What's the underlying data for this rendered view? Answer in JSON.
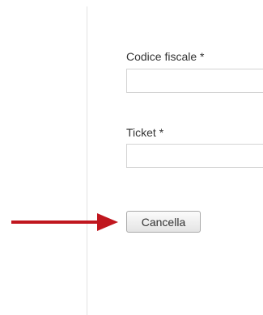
{
  "form": {
    "fiscal_code_label": "Codice fiscale *",
    "fiscal_code_value": "",
    "ticket_label": "Ticket *",
    "ticket_value": "",
    "cancel_label": "Cancella"
  },
  "annotation": {
    "arrow_color": "#c0161e",
    "arrow_icon": "arrow-right-icon"
  }
}
